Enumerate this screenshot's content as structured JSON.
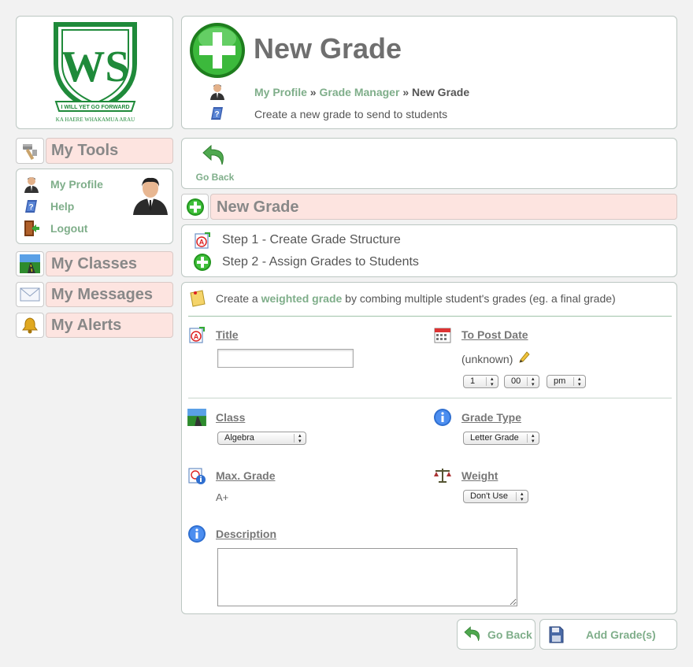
{
  "logo": {
    "letters": "WS",
    "motto_ribbon": "I WILL YET GO FORWARD",
    "motto_bottom": "KA HAERE WHAKAMUA ARAU"
  },
  "header": {
    "title": "New Grade",
    "breadcrumb": [
      {
        "label": "My Profile"
      },
      {
        "label": "Grade Manager"
      },
      {
        "label": "New Grade"
      }
    ],
    "separator": "»",
    "description": "Create a new grade to send to students"
  },
  "sidebar": {
    "tools_title": "My Tools",
    "profile_links": [
      {
        "label": "My Profile",
        "icon": "user-icon"
      },
      {
        "label": "Help",
        "icon": "help-book-icon"
      },
      {
        "label": "Logout",
        "icon": "logout-door-icon"
      }
    ],
    "sections": [
      {
        "label": "My Classes",
        "icon": "classes-road-icon"
      },
      {
        "label": "My Messages",
        "icon": "envelope-icon"
      },
      {
        "label": "My Alerts",
        "icon": "bell-icon"
      }
    ]
  },
  "toolbar": {
    "go_back": "Go Back"
  },
  "section": {
    "title": "New Grade"
  },
  "steps": [
    {
      "label": "Step 1 - Create Grade Structure",
      "icon": "grade-a-icon"
    },
    {
      "label": "Step 2 - Assign Grades to Students",
      "icon": "green-plus-icon"
    }
  ],
  "intro": {
    "before": "Create a ",
    "link": "weighted grade",
    "after": " by combing multiple student's grades (eg. a final grade)"
  },
  "form": {
    "title_label": "Title",
    "title_value": "",
    "post_date_label": "To Post Date",
    "post_date_value": "(unknown)",
    "hour": "1",
    "minute": "00",
    "ampm": "pm",
    "class_label": "Class",
    "class_value": "Algebra",
    "grade_type_label": "Grade Type",
    "grade_type_value": "Letter Grade",
    "max_grade_label": "Max. Grade",
    "max_grade_value": "A+",
    "weight_label": "Weight",
    "weight_value": "Don't Use",
    "description_label": "Description",
    "description_value": ""
  },
  "footer": {
    "go_back": "Go Back",
    "add": "Add Grade(s)"
  },
  "colors": {
    "accent_green": "#7fae8a",
    "pink_bar": "#fde4e0",
    "logo_green": "#1f8a3a"
  }
}
